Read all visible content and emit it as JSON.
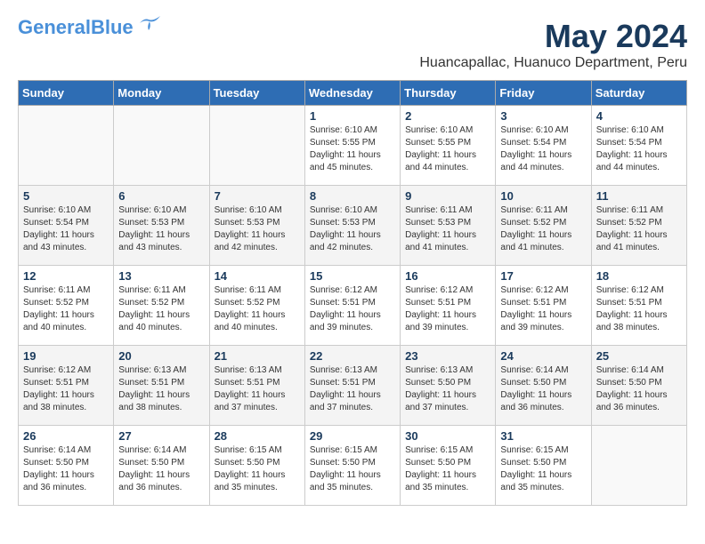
{
  "app": {
    "logo_line1": "General",
    "logo_line2": "Blue",
    "title": "May 2024",
    "subtitle": "Huancapallac, Huanuco Department, Peru"
  },
  "weekdays": [
    "Sunday",
    "Monday",
    "Tuesday",
    "Wednesday",
    "Thursday",
    "Friday",
    "Saturday"
  ],
  "weeks": [
    [
      {
        "day": "",
        "info": ""
      },
      {
        "day": "",
        "info": ""
      },
      {
        "day": "",
        "info": ""
      },
      {
        "day": "1",
        "info": "Sunrise: 6:10 AM\nSunset: 5:55 PM\nDaylight: 11 hours\nand 45 minutes."
      },
      {
        "day": "2",
        "info": "Sunrise: 6:10 AM\nSunset: 5:55 PM\nDaylight: 11 hours\nand 44 minutes."
      },
      {
        "day": "3",
        "info": "Sunrise: 6:10 AM\nSunset: 5:54 PM\nDaylight: 11 hours\nand 44 minutes."
      },
      {
        "day": "4",
        "info": "Sunrise: 6:10 AM\nSunset: 5:54 PM\nDaylight: 11 hours\nand 44 minutes."
      }
    ],
    [
      {
        "day": "5",
        "info": "Sunrise: 6:10 AM\nSunset: 5:54 PM\nDaylight: 11 hours\nand 43 minutes."
      },
      {
        "day": "6",
        "info": "Sunrise: 6:10 AM\nSunset: 5:53 PM\nDaylight: 11 hours\nand 43 minutes."
      },
      {
        "day": "7",
        "info": "Sunrise: 6:10 AM\nSunset: 5:53 PM\nDaylight: 11 hours\nand 42 minutes."
      },
      {
        "day": "8",
        "info": "Sunrise: 6:10 AM\nSunset: 5:53 PM\nDaylight: 11 hours\nand 42 minutes."
      },
      {
        "day": "9",
        "info": "Sunrise: 6:11 AM\nSunset: 5:53 PM\nDaylight: 11 hours\nand 41 minutes."
      },
      {
        "day": "10",
        "info": "Sunrise: 6:11 AM\nSunset: 5:52 PM\nDaylight: 11 hours\nand 41 minutes."
      },
      {
        "day": "11",
        "info": "Sunrise: 6:11 AM\nSunset: 5:52 PM\nDaylight: 11 hours\nand 41 minutes."
      }
    ],
    [
      {
        "day": "12",
        "info": "Sunrise: 6:11 AM\nSunset: 5:52 PM\nDaylight: 11 hours\nand 40 minutes."
      },
      {
        "day": "13",
        "info": "Sunrise: 6:11 AM\nSunset: 5:52 PM\nDaylight: 11 hours\nand 40 minutes."
      },
      {
        "day": "14",
        "info": "Sunrise: 6:11 AM\nSunset: 5:52 PM\nDaylight: 11 hours\nand 40 minutes."
      },
      {
        "day": "15",
        "info": "Sunrise: 6:12 AM\nSunset: 5:51 PM\nDaylight: 11 hours\nand 39 minutes."
      },
      {
        "day": "16",
        "info": "Sunrise: 6:12 AM\nSunset: 5:51 PM\nDaylight: 11 hours\nand 39 minutes."
      },
      {
        "day": "17",
        "info": "Sunrise: 6:12 AM\nSunset: 5:51 PM\nDaylight: 11 hours\nand 39 minutes."
      },
      {
        "day": "18",
        "info": "Sunrise: 6:12 AM\nSunset: 5:51 PM\nDaylight: 11 hours\nand 38 minutes."
      }
    ],
    [
      {
        "day": "19",
        "info": "Sunrise: 6:12 AM\nSunset: 5:51 PM\nDaylight: 11 hours\nand 38 minutes."
      },
      {
        "day": "20",
        "info": "Sunrise: 6:13 AM\nSunset: 5:51 PM\nDaylight: 11 hours\nand 38 minutes."
      },
      {
        "day": "21",
        "info": "Sunrise: 6:13 AM\nSunset: 5:51 PM\nDaylight: 11 hours\nand 37 minutes."
      },
      {
        "day": "22",
        "info": "Sunrise: 6:13 AM\nSunset: 5:51 PM\nDaylight: 11 hours\nand 37 minutes."
      },
      {
        "day": "23",
        "info": "Sunrise: 6:13 AM\nSunset: 5:50 PM\nDaylight: 11 hours\nand 37 minutes."
      },
      {
        "day": "24",
        "info": "Sunrise: 6:14 AM\nSunset: 5:50 PM\nDaylight: 11 hours\nand 36 minutes."
      },
      {
        "day": "25",
        "info": "Sunrise: 6:14 AM\nSunset: 5:50 PM\nDaylight: 11 hours\nand 36 minutes."
      }
    ],
    [
      {
        "day": "26",
        "info": "Sunrise: 6:14 AM\nSunset: 5:50 PM\nDaylight: 11 hours\nand 36 minutes."
      },
      {
        "day": "27",
        "info": "Sunrise: 6:14 AM\nSunset: 5:50 PM\nDaylight: 11 hours\nand 36 minutes."
      },
      {
        "day": "28",
        "info": "Sunrise: 6:15 AM\nSunset: 5:50 PM\nDaylight: 11 hours\nand 35 minutes."
      },
      {
        "day": "29",
        "info": "Sunrise: 6:15 AM\nSunset: 5:50 PM\nDaylight: 11 hours\nand 35 minutes."
      },
      {
        "day": "30",
        "info": "Sunrise: 6:15 AM\nSunset: 5:50 PM\nDaylight: 11 hours\nand 35 minutes."
      },
      {
        "day": "31",
        "info": "Sunrise: 6:15 AM\nSunset: 5:50 PM\nDaylight: 11 hours\nand 35 minutes."
      },
      {
        "day": "",
        "info": ""
      }
    ]
  ]
}
